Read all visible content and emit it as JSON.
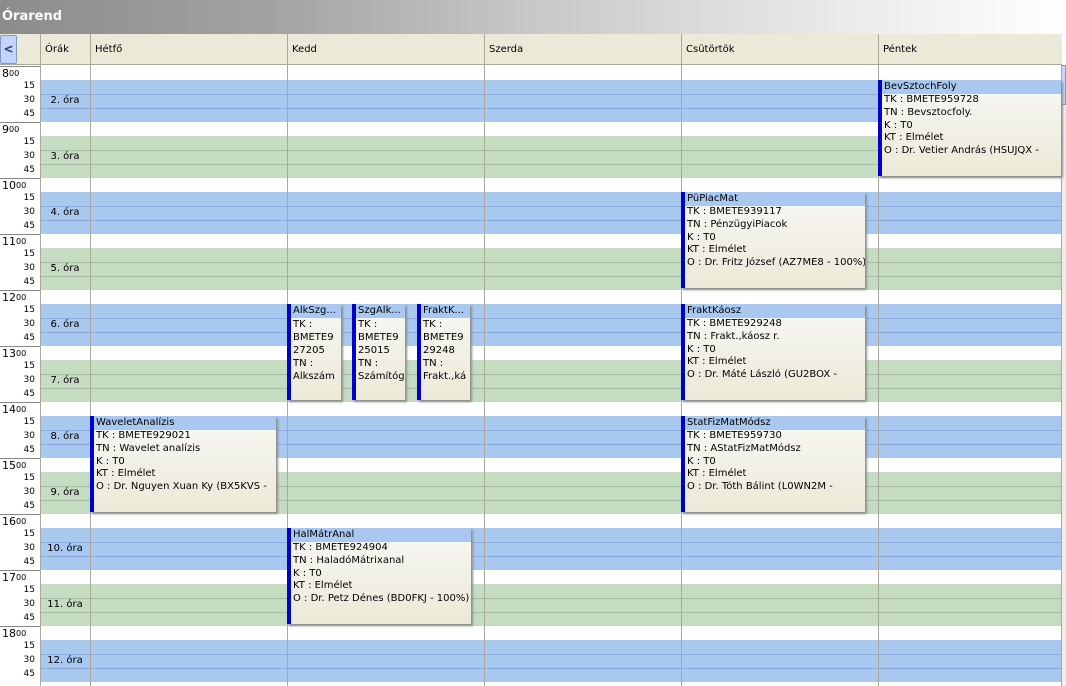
{
  "window": {
    "title": "Órarend"
  },
  "nav": {
    "prev_glyph": "<"
  },
  "header": {
    "hours_col": "Órák",
    "days": [
      "Hétfő",
      "Kedd",
      "Szerda",
      "Csütörtök",
      "Péntek"
    ]
  },
  "hours": [
    "8",
    "9",
    "10",
    "11",
    "12",
    "13",
    "14",
    "15",
    "16",
    "17",
    "18"
  ],
  "minute_marks": [
    "00",
    "15",
    "30",
    "45"
  ],
  "periods": [
    "2. óra",
    "3. óra",
    "4. óra",
    "5. óra",
    "6. óra",
    "7. óra",
    "8. óra",
    "9. óra",
    "10. óra",
    "11. óra",
    "12. óra"
  ],
  "events": [
    {
      "day": "Péntek",
      "title": "BevSztochFoly",
      "lines": [
        "TK : BMETE959728",
        "TN : Bevsztocfoly.",
        "K : T0",
        "KT : Elmélet",
        "O :  Dr. Vetier András (HSUJQX -"
      ]
    },
    {
      "day": "Csütörtök",
      "title": "PüPiacMat",
      "lines": [
        "TK : BMETE939117",
        "TN : PénzügyiPiacok",
        "K : T0",
        "KT : Elmélet",
        "O :  Dr. Fritz József (AZ7ME8 - 100%)"
      ]
    },
    {
      "day": "Kedd",
      "title": "AlkSzg...",
      "lines": [
        "TK :",
        "BMETE9",
        "27205",
        "TN :",
        "Alkszám"
      ]
    },
    {
      "day": "Kedd",
      "title": "SzgAlk...",
      "lines": [
        "TK :",
        "BMETE9",
        "25015",
        "TN :",
        "Számítóg"
      ]
    },
    {
      "day": "Kedd",
      "title": "FraktK...",
      "lines": [
        "TK :",
        "BMETE9",
        "29248",
        "TN :",
        "Frakt.,ká"
      ]
    },
    {
      "day": "Csütörtök",
      "title": "FraktKáosz",
      "lines": [
        "TK : BMETE929248",
        "TN : Frakt.,káosz r.",
        "K : T0",
        "KT : Elmélet",
        "O :  Dr. Máté László (GU2BOX -"
      ]
    },
    {
      "day": "Hétfő",
      "title": "WaveletAnalízis",
      "lines": [
        "TK : BMETE929021",
        "TN : Wavelet analízis",
        "K : T0",
        "KT : Elmélet",
        "O :  Dr. Nguyen Xuan Ky (BX5KVS -"
      ]
    },
    {
      "day": "Csütörtök",
      "title": "StatFizMatMódsz",
      "lines": [
        "TK : BMETE959730",
        "TN : AStatFizMatMódsz",
        "K : T0",
        "KT : Elmélet",
        "O :  Dr. Tóth Bálint (L0WN2M -"
      ]
    },
    {
      "day": "Kedd",
      "title": "HalMátrAnal",
      "lines": [
        "TK : BMETE924904",
        "TN : HaladóMátrixanal",
        "K : T0",
        "KT : Elmélet",
        "O :  Dr. Petz Dénes (BD0FKJ - 100%)"
      ]
    }
  ],
  "colors": {
    "period_even": "#a8c8f0",
    "period_odd": "#c5dbc2",
    "accent": "#0000cd"
  }
}
